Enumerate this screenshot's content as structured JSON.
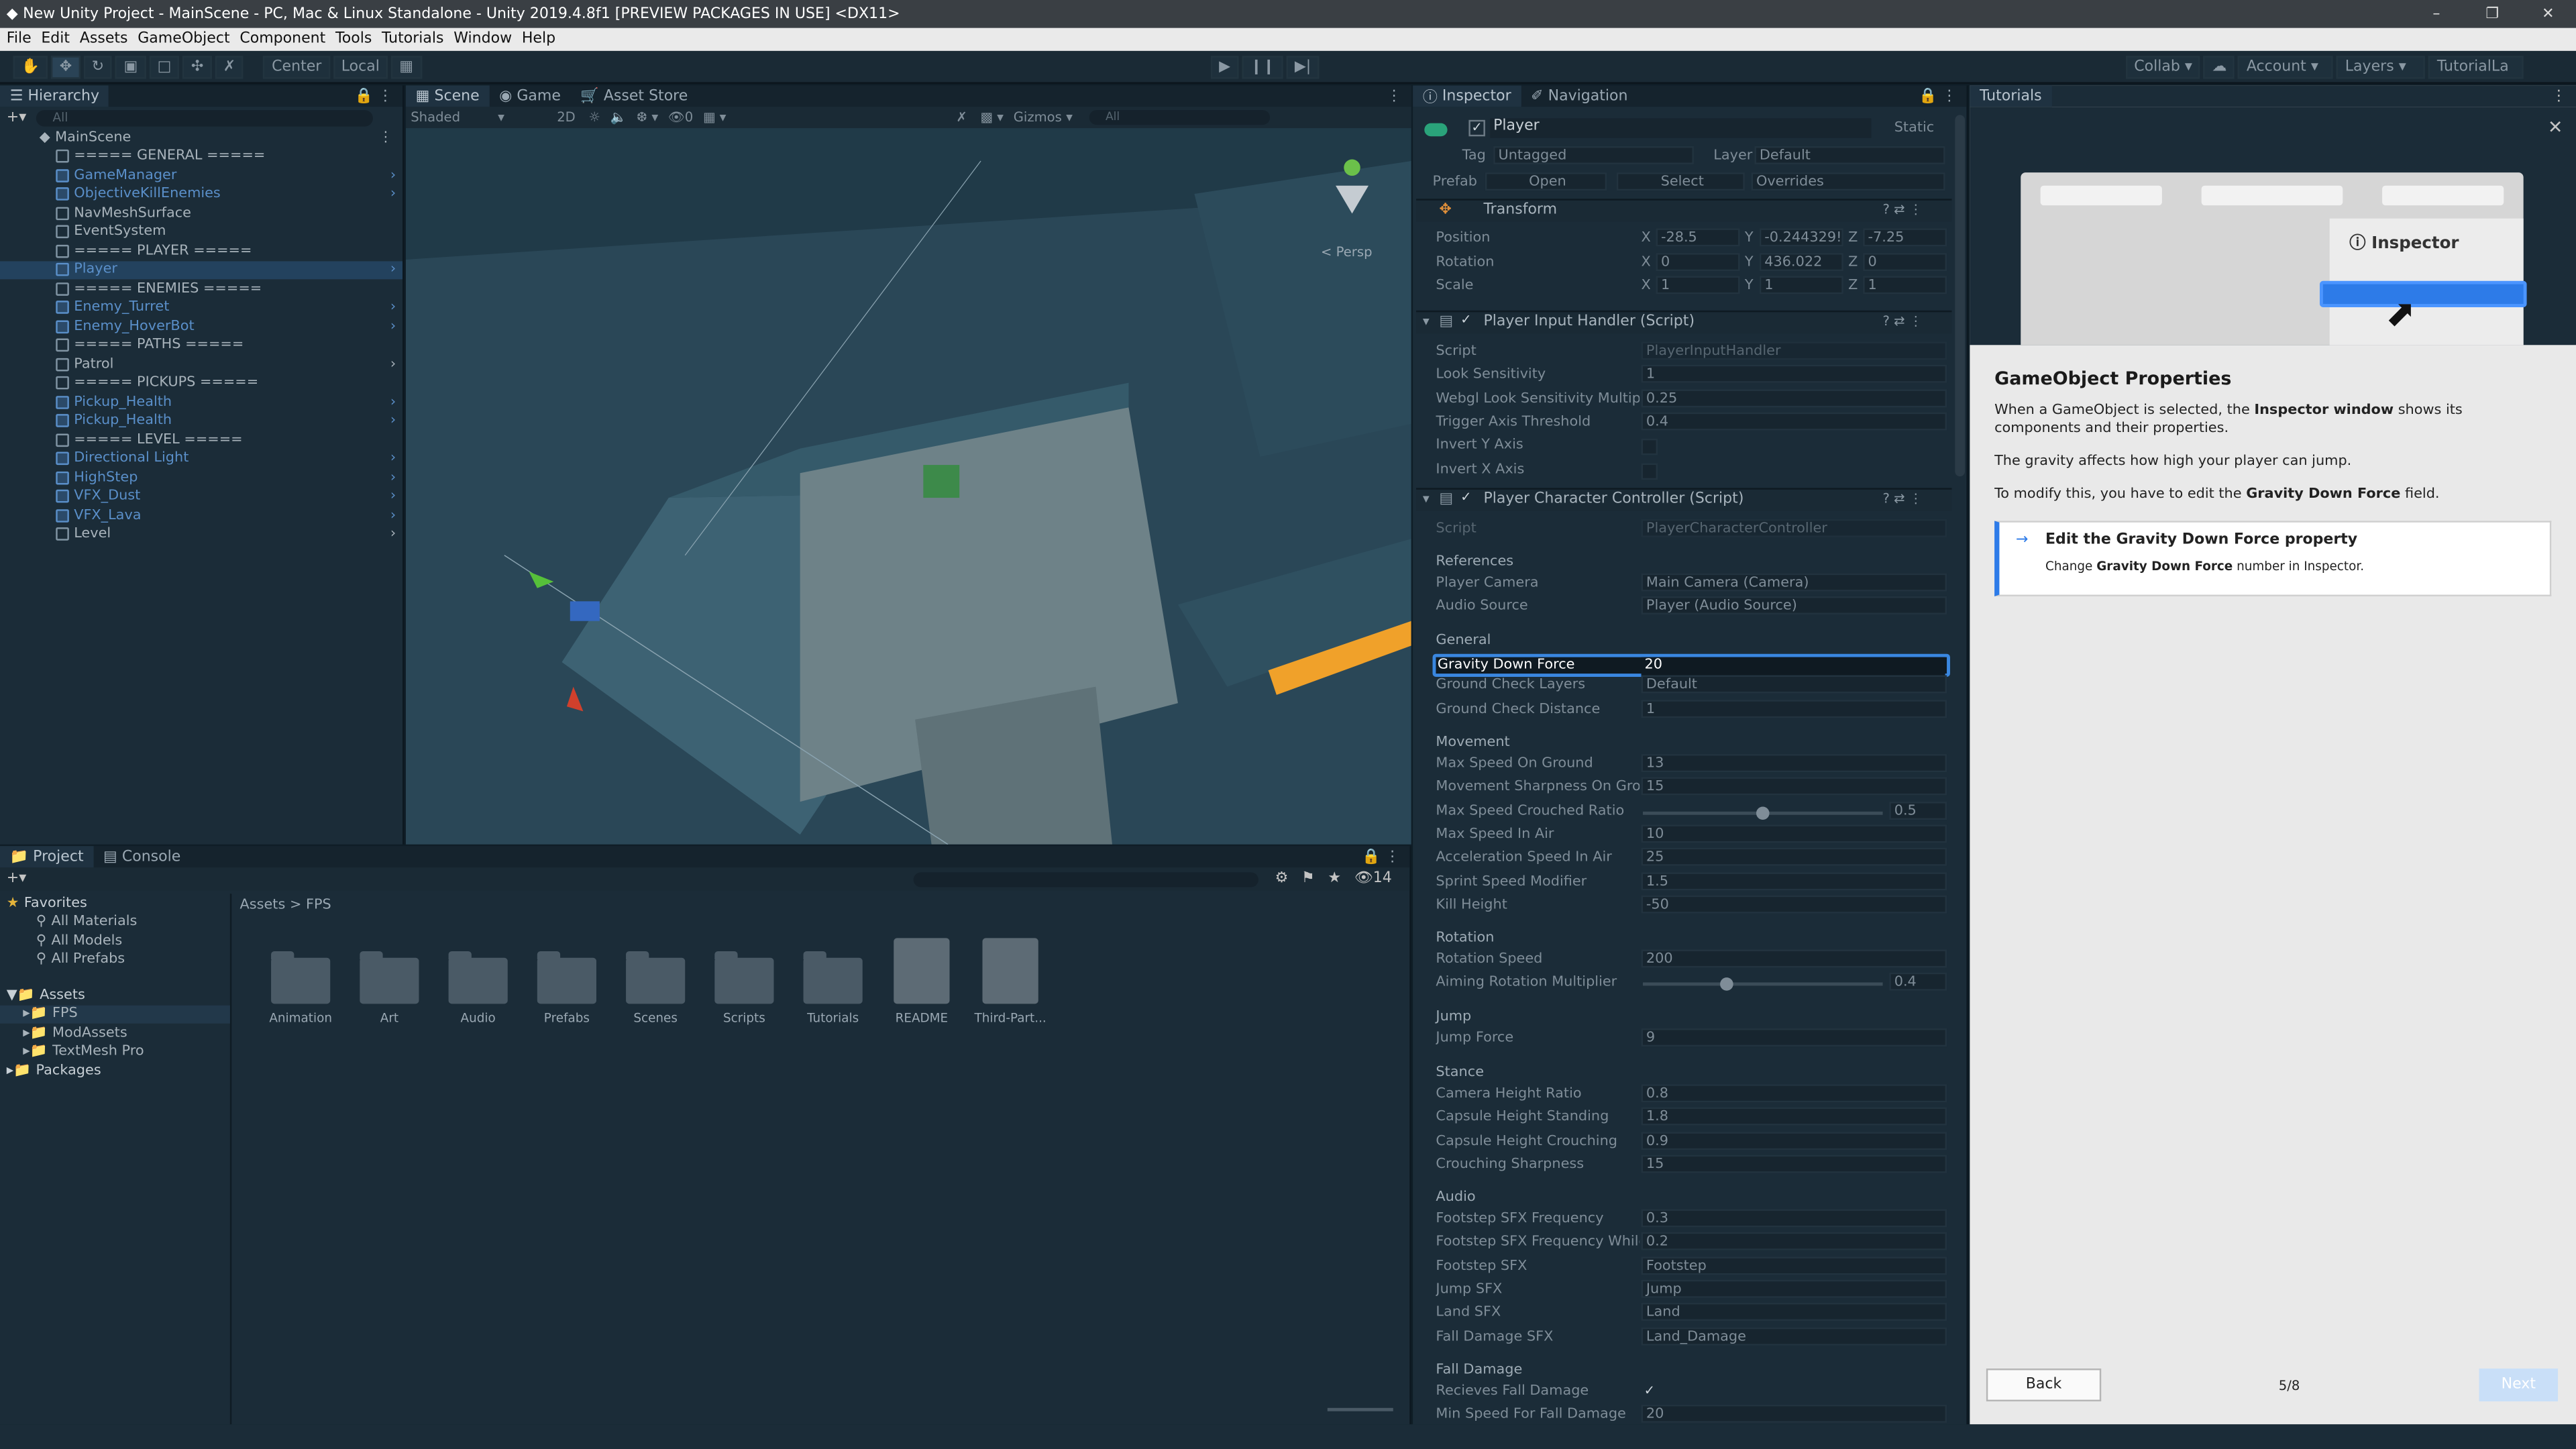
{
  "window": {
    "title": "New Unity Project - MainScene - PC, Mac & Linux Standalone - Unity 2019.4.8f1 [PREVIEW PACKAGES IN USE] <DX11>",
    "controls": [
      "–",
      "❐",
      "✕"
    ]
  },
  "menu": [
    "File",
    "Edit",
    "Assets",
    "GameObject",
    "Component",
    "Tools",
    "Tutorials",
    "Window",
    "Help"
  ],
  "toolbar": {
    "pivot": "Center",
    "space": "Local",
    "collab": "Collab",
    "account": "Account",
    "layers": "Layers",
    "layout": "TutorialLa"
  },
  "hierarchy": {
    "tab": "Hierarchy",
    "search_placeholder": "All",
    "scene": "MainScene",
    "items": [
      {
        "label": "===== GENERAL =====",
        "blue": false,
        "arrow": false
      },
      {
        "label": "GameManager",
        "blue": true,
        "arrow": true
      },
      {
        "label": "ObjectiveKillEnemies",
        "blue": true,
        "arrow": true
      },
      {
        "label": "NavMeshSurface",
        "blue": false,
        "arrow": false
      },
      {
        "label": "EventSystem",
        "blue": false,
        "arrow": false
      },
      {
        "label": "===== PLAYER =====",
        "blue": false,
        "arrow": false
      },
      {
        "label": "Player",
        "blue": true,
        "arrow": true,
        "selected": true
      },
      {
        "label": "===== ENEMIES =====",
        "blue": false,
        "arrow": false
      },
      {
        "label": "Enemy_Turret",
        "blue": true,
        "arrow": true
      },
      {
        "label": "Enemy_HoverBot",
        "blue": true,
        "arrow": true
      },
      {
        "label": "===== PATHS =====",
        "blue": false,
        "arrow": false
      },
      {
        "label": "Patrol",
        "blue": false,
        "arrow": true
      },
      {
        "label": "===== PICKUPS =====",
        "blue": false,
        "arrow": false
      },
      {
        "label": "Pickup_Health",
        "blue": true,
        "arrow": true
      },
      {
        "label": "Pickup_Health",
        "blue": true,
        "arrow": true
      },
      {
        "label": "===== LEVEL =====",
        "blue": false,
        "arrow": false
      },
      {
        "label": "Directional Light",
        "blue": true,
        "arrow": true
      },
      {
        "label": "HighStep",
        "blue": true,
        "arrow": true
      },
      {
        "label": "VFX_Dust",
        "blue": true,
        "arrow": true
      },
      {
        "label": "VFX_Lava",
        "blue": true,
        "arrow": true
      },
      {
        "label": "Level",
        "blue": false,
        "arrow": true
      }
    ]
  },
  "scene": {
    "tabs": [
      "Scene",
      "Game",
      "Asset Store"
    ],
    "shading": "Shaded",
    "mode2d": "2D",
    "gizmos": "Gizmos",
    "search_placeholder": "All",
    "persp": "< Persp"
  },
  "project": {
    "tabs": [
      "Project",
      "Console"
    ],
    "badge": "14",
    "breadcrumb": [
      "Assets",
      "FPS"
    ],
    "favorites": "Favorites",
    "fav_items": [
      "All Materials",
      "All Models",
      "All Prefabs"
    ],
    "assets_root": "Assets",
    "asset_tree": [
      "FPS",
      "ModAssets",
      "TextMesh Pro"
    ],
    "packages": "Packages",
    "assets": [
      {
        "name": "Animation",
        "kind": "folder"
      },
      {
        "name": "Art",
        "kind": "folder"
      },
      {
        "name": "Audio",
        "kind": "folder"
      },
      {
        "name": "Prefabs",
        "kind": "folder"
      },
      {
        "name": "Scenes",
        "kind": "folder"
      },
      {
        "name": "Scripts",
        "kind": "folder"
      },
      {
        "name": "Tutorials",
        "kind": "folder"
      },
      {
        "name": "README",
        "kind": "doc"
      },
      {
        "name": "Third-Part...",
        "kind": "doc"
      }
    ]
  },
  "inspector": {
    "tabs": [
      "Inspector",
      "Navigation"
    ],
    "object_name": "Player",
    "static": "Static",
    "tag_label": "Tag",
    "tag": "Untagged",
    "layer_label": "Layer",
    "layer": "Default",
    "prefab_label": "Prefab",
    "prefab_open": "Open",
    "prefab_select": "Select",
    "prefab_overrides": "Overrides",
    "transform": {
      "title": "Transform",
      "position_label": "Position",
      "rotation_label": "Rotation",
      "scale_label": "Scale",
      "position": [
        "-28.5",
        "-0.244329!",
        "-7.25"
      ],
      "rotation": [
        "0",
        "436.022",
        "0"
      ],
      "scale": [
        "1",
        "1",
        "1"
      ]
    },
    "input_handler": {
      "title": "Player Input Handler (Script)",
      "rows": [
        {
          "label": "Script",
          "value": "PlayerInputHandler"
        },
        {
          "label": "Look Sensitivity",
          "value": "1"
        },
        {
          "label": "Webgl Look Sensitivity Multiplie",
          "value": "0.25"
        },
        {
          "label": "Trigger Axis Threshold",
          "value": "0.4"
        },
        {
          "label": "Invert Y Axis",
          "value": ""
        },
        {
          "label": "Invert X Axis",
          "value": ""
        }
      ]
    },
    "controller": {
      "title": "Player Character Controller (Script)",
      "script_label": "Script",
      "script_value": "PlayerCharacterController",
      "sections": [
        {
          "header": "References",
          "rows": [
            {
              "label": "Player Camera",
              "value": "Main Camera (Camera)"
            },
            {
              "label": "Audio Source",
              "value": "Player (Audio Source)"
            }
          ]
        },
        {
          "header": "General",
          "rows": [
            {
              "label": "Gravity Down Force",
              "value": "20",
              "highlight": true
            },
            {
              "label": "Ground Check Layers",
              "value": "Default"
            },
            {
              "label": "Ground Check Distance",
              "value": "1"
            }
          ]
        },
        {
          "header": "Movement",
          "rows": [
            {
              "label": "Max Speed On Ground",
              "value": "13"
            },
            {
              "label": "Movement Sharpness On Grou",
              "value": "15"
            },
            {
              "label": "Max Speed Crouched Ratio",
              "value": "0.5",
              "slider": 0.5
            },
            {
              "label": "Max Speed In Air",
              "value": "10"
            },
            {
              "label": "Acceleration Speed In Air",
              "value": "25"
            },
            {
              "label": "Sprint Speed Modifier",
              "value": "1.5"
            },
            {
              "label": "Kill Height",
              "value": "-50"
            }
          ]
        },
        {
          "header": "Rotation",
          "rows": [
            {
              "label": "Rotation Speed",
              "value": "200"
            },
            {
              "label": "Aiming Rotation Multiplier",
              "value": "0.4",
              "slider": 0.35
            }
          ]
        },
        {
          "header": "Jump",
          "rows": [
            {
              "label": "Jump Force",
              "value": "9"
            }
          ]
        },
        {
          "header": "Stance",
          "rows": [
            {
              "label": "Camera Height Ratio",
              "value": "0.8"
            },
            {
              "label": "Capsule Height Standing",
              "value": "1.8"
            },
            {
              "label": "Capsule Height Crouching",
              "value": "0.9"
            },
            {
              "label": "Crouching Sharpness",
              "value": "15"
            }
          ]
        },
        {
          "header": "Audio",
          "rows": [
            {
              "label": "Footstep SFX Frequency",
              "value": "0.3"
            },
            {
              "label": "Footstep SFX Frequency While",
              "value": "0.2"
            },
            {
              "label": "Footstep SFX",
              "value": "Footstep"
            },
            {
              "label": "Jump SFX",
              "value": "Jump"
            },
            {
              "label": "Land SFX",
              "value": "Land"
            },
            {
              "label": "Fall Damage SFX",
              "value": "Land_Damage"
            }
          ]
        },
        {
          "header": "Fall Damage",
          "rows": [
            {
              "label": "Recieves Fall Damage",
              "value": "✓"
            },
            {
              "label": "Min Speed For Fall Damage",
              "value": "20"
            }
          ]
        }
      ]
    }
  },
  "tutorial": {
    "tab": "Tutorials",
    "illustration_label": "Inspector",
    "heading": "GameObject Properties",
    "para1_a": "When a GameObject is selected, the ",
    "para1_b": "Inspector window",
    "para1_c": " shows its components and their properties.",
    "para2": "The gravity affects how high your player can jump.",
    "para3_a": "To modify this, you have to edit the ",
    "para3_b": "Gravity Down Force",
    "para3_c": " field.",
    "task_title": "Edit the Gravity Down Force property",
    "task_desc_a": "Change ",
    "task_desc_b": "Gravity Down Force",
    "task_desc_c": " number in Inspector.",
    "back": "Back",
    "page": "5/8",
    "next": "Next"
  }
}
